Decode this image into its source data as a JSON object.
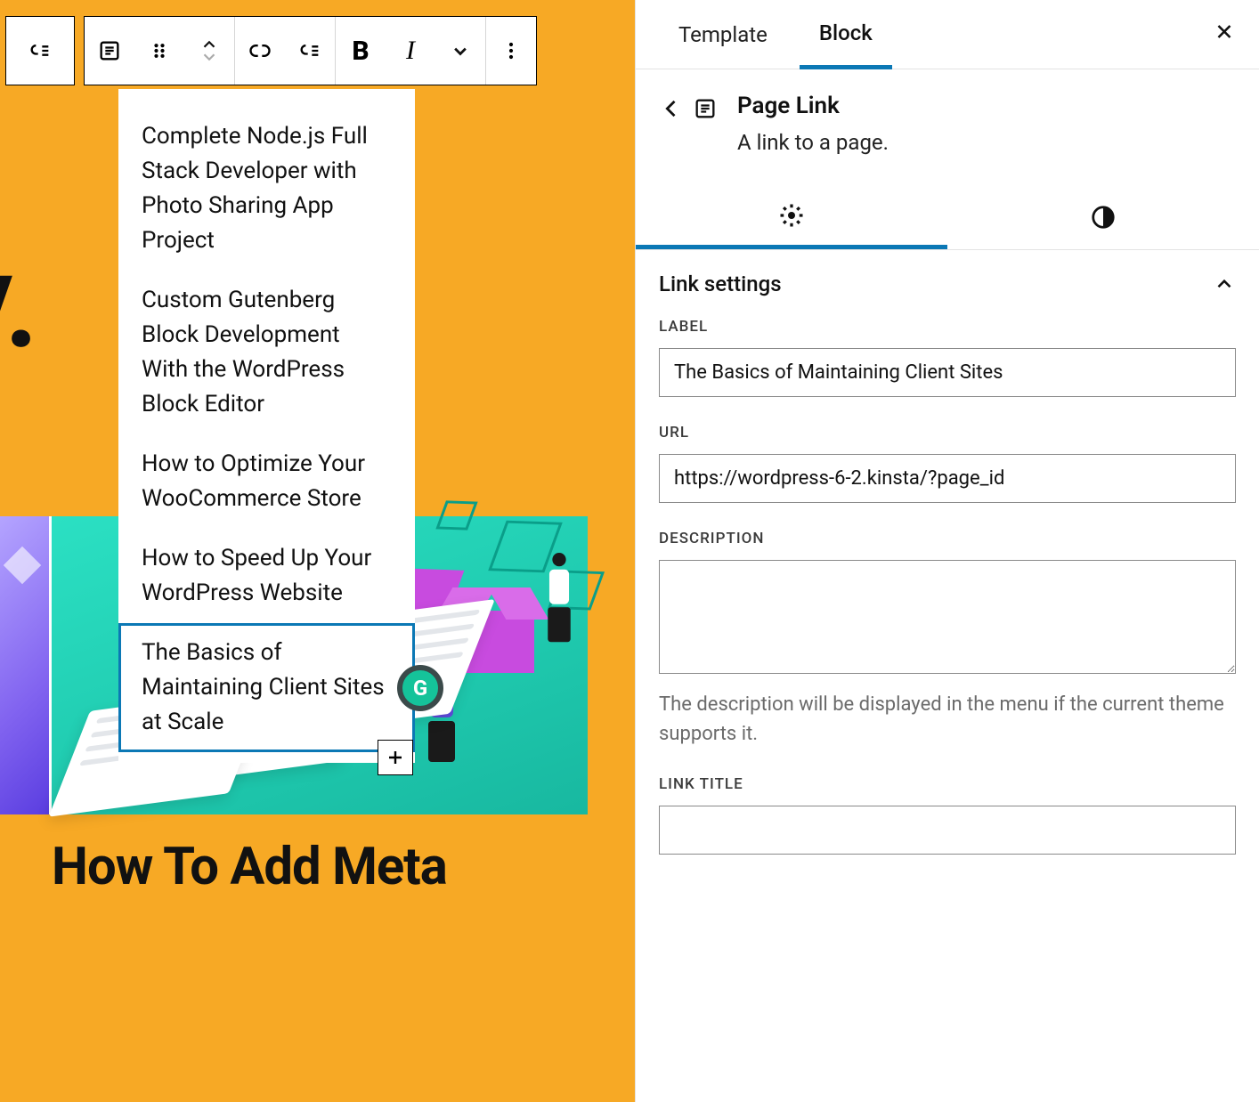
{
  "canvas": {
    "partial_heading": "hy.",
    "bottom_headline": "How To Add Meta"
  },
  "toolbar": {
    "bold_label": "B",
    "italic_label": "I"
  },
  "submenu": {
    "items": [
      "Complete Node.js Full Stack Developer with Photo Sharing App Project",
      "Custom Gutenberg Block Development With the WordPress Block Editor",
      "How to Optimize Your WooCommerce Store",
      "How to Speed Up Your WordPress Website",
      "The Basics of Maintaining Client Sites at Scale"
    ],
    "selected_index": 4
  },
  "sidebar": {
    "tabs": {
      "template": "Template",
      "block": "Block"
    },
    "blockcard": {
      "title": "Page Link",
      "description": "A link to a page."
    },
    "panel": {
      "title": "Link settings",
      "label_heading": "LABEL",
      "label_value": "The Basics of Maintaining Client Sites",
      "url_heading": "URL",
      "url_value": "https://wordpress-6-2.kinsta/?page_id",
      "description_heading": "DESCRIPTION",
      "description_value": "",
      "description_hint": "The description will be displayed in the menu if the current theme supports it.",
      "link_title_heading": "LINK TITLE",
      "link_title_value": ""
    }
  }
}
